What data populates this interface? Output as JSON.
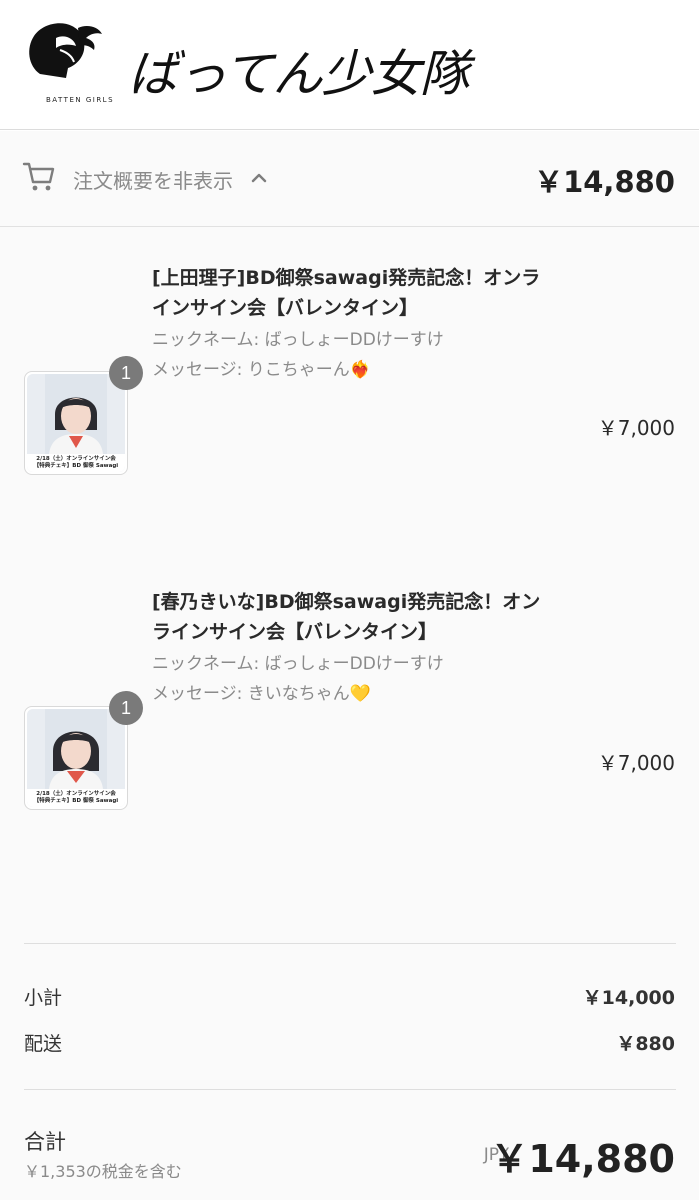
{
  "header": {
    "logo_text": "ばってん少女隊",
    "logo_subtitle": "BATTEN GIRLS"
  },
  "summary": {
    "toggle_label": "注文概要を非表示",
    "total": "￥14,880"
  },
  "items": [
    {
      "title": "[上田理子]BD御祭sawagi発売記念！オンラインサイン会【バレンタイン】",
      "nickname": "ニックネーム: ばっしょーDDけーすけ",
      "message": "メッセージ: りこちゃーん❤️‍🔥",
      "quantity": "1",
      "price": "￥7,000",
      "thumb_caption_1": "2/18（土）オンラインサイン会",
      "thumb_caption_2": "【特典チェキ】BD 御祭 Sawagi"
    },
    {
      "title": "[春乃きいな]BD御祭sawagi発売記念！オンラインサイン会【バレンタイン】",
      "nickname": "ニックネーム: ばっしょーDDけーすけ",
      "message": "メッセージ: きいなちゃん💛",
      "quantity": "1",
      "price": "￥7,000",
      "thumb_caption_1": "2/18（土）オンラインサイン会",
      "thumb_caption_2": "【特典チェキ】BD 御祭 Sawagi"
    }
  ],
  "totals": {
    "subtotal_label": "小計",
    "subtotal_value": "￥14,000",
    "shipping_label": "配送",
    "shipping_value": "￥880",
    "total_label": "合計",
    "tax_note": "￥1,353の税金を含む",
    "currency": "JPY",
    "grand_total": "￥14,880"
  }
}
